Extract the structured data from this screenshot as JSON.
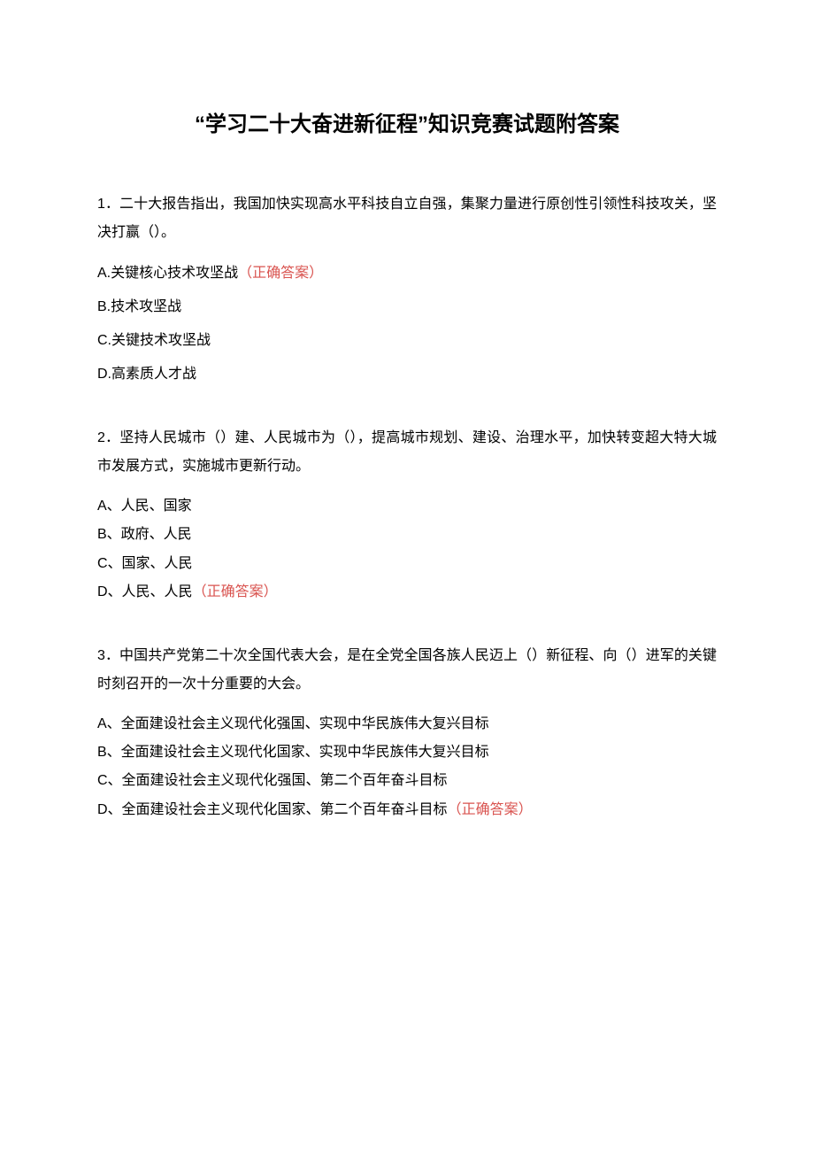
{
  "title": "“学习二十大奋进新征程”知识竞赛试题附答案",
  "correct_label": "（正确答案）",
  "questions": [
    {
      "num": "1",
      "stem": "．二十大报告指出，我国加快实现高水平科技自立自强，集聚力量进行原创性引领性科技攻关，坚决打赢（）。",
      "options": [
        {
          "label": "A.关键核心技术攻坚战",
          "correct": true
        },
        {
          "label": "B.技术攻坚战",
          "correct": false
        },
        {
          "label": "C.关键技术攻坚战",
          "correct": false
        },
        {
          "label": "D.高素质人才战",
          "correct": false
        }
      ],
      "spacing": "loose"
    },
    {
      "num": "2",
      "stem": "．坚持人民城市（）建、人民城市为（），提高城市规划、建设、治理水平，加快转变超大特大城市发展方式，实施城市更新行动。",
      "options": [
        {
          "label": "A、人民、国家",
          "correct": false
        },
        {
          "label": "B、政府、人民",
          "correct": false
        },
        {
          "label": "C、国家、人民",
          "correct": false
        },
        {
          "label": "D、人民、人民",
          "correct": true
        }
      ],
      "spacing": "tight"
    },
    {
      "num": "3",
      "stem": "．中国共产党第二十次全国代表大会，是在全党全国各族人民迈上（）新征程、向（）进军的关键时刻召开的一次十分重要的大会。",
      "options": [
        {
          "label": "A、全面建设社会主义现代化强国、实现中华民族伟大复兴目标",
          "correct": false
        },
        {
          "label": "B、全面建设社会主义现代化国家、实现中华民族伟大复兴目标",
          "correct": false
        },
        {
          "label": "C、全面建设社会主义现代化强国、第二个百年奋斗目标",
          "correct": false
        },
        {
          "label": "D、全面建设社会主义现代化国家、第二个百年奋斗目标",
          "correct": true
        }
      ],
      "spacing": "tight"
    }
  ]
}
